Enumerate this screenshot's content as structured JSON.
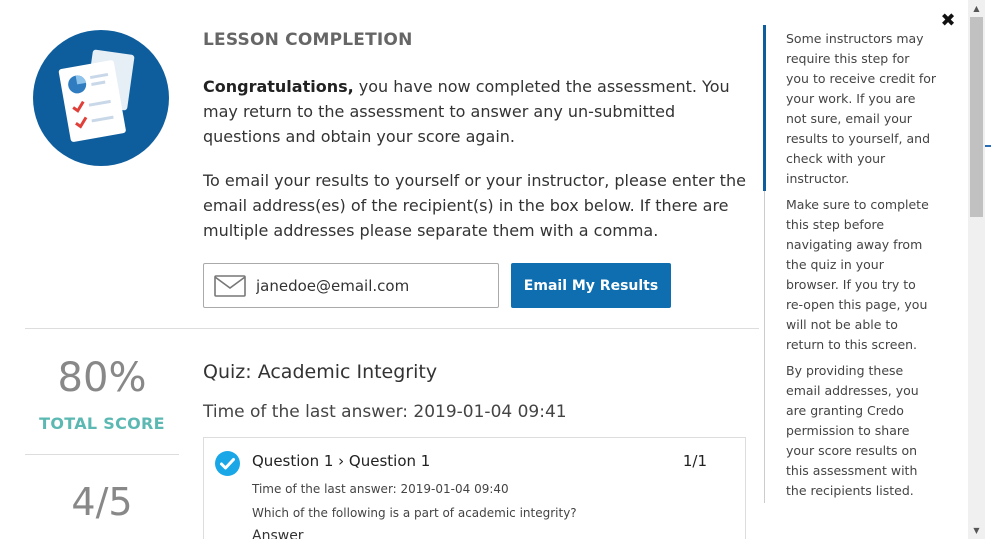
{
  "header": {
    "title": "LESSON COMPLETION"
  },
  "intro": {
    "bold": "Congratulations,",
    "text": " you have now completed the assessment. You may return to the assessment to answer any un-submitted questions and obtain your score again."
  },
  "instructions": "To email your results to yourself or your instructor, please enter the email address(es) of the recipient(s) in the box below. If there are multiple addresses please separate them with a comma.",
  "email": {
    "value": "janedoe@email.com",
    "button_label": "Email My Results"
  },
  "score": {
    "percent": "80%",
    "label": "TOTAL SCORE",
    "fraction": "4/5",
    "percent_value": 80
  },
  "quiz": {
    "title": "Quiz: Academic Integrity",
    "last_answer": "Time of the last answer: 2019-01-04 09:41",
    "questions": [
      {
        "title": "Question 1 › Question 1",
        "score": "1/1",
        "time": "Time of the last answer: 2019-01-04 09:40",
        "text": "Which of the following is a part of academic integrity?",
        "answer_label": "Answer"
      }
    ]
  },
  "side_note": {
    "p1": "Some instructors may require this step for you to receive credit for your work. If you are not sure, email your results to yourself, and check with your instructor.",
    "p2": "Make sure to complete this step before navigating away from the quiz in your browser. If you try to re-open this page, you will not be able to return to this screen.",
    "p3": "By providing these email addresses, you are granting Credo permission to share your score results on this assessment with the recipients listed."
  },
  "close_label": "✖",
  "scrollbar": {
    "up": "▲",
    "down": "▼"
  },
  "colors": {
    "brand_blue": "#0e5e9e",
    "button_blue": "#0e6eb0",
    "score_teal": "#5cb8b2",
    "check_blue": "#1aa7e8"
  },
  "icons": {
    "lesson": "report-document-icon",
    "email": "envelope-icon",
    "check": "checkmark-circle-icon",
    "close": "close-icon"
  }
}
